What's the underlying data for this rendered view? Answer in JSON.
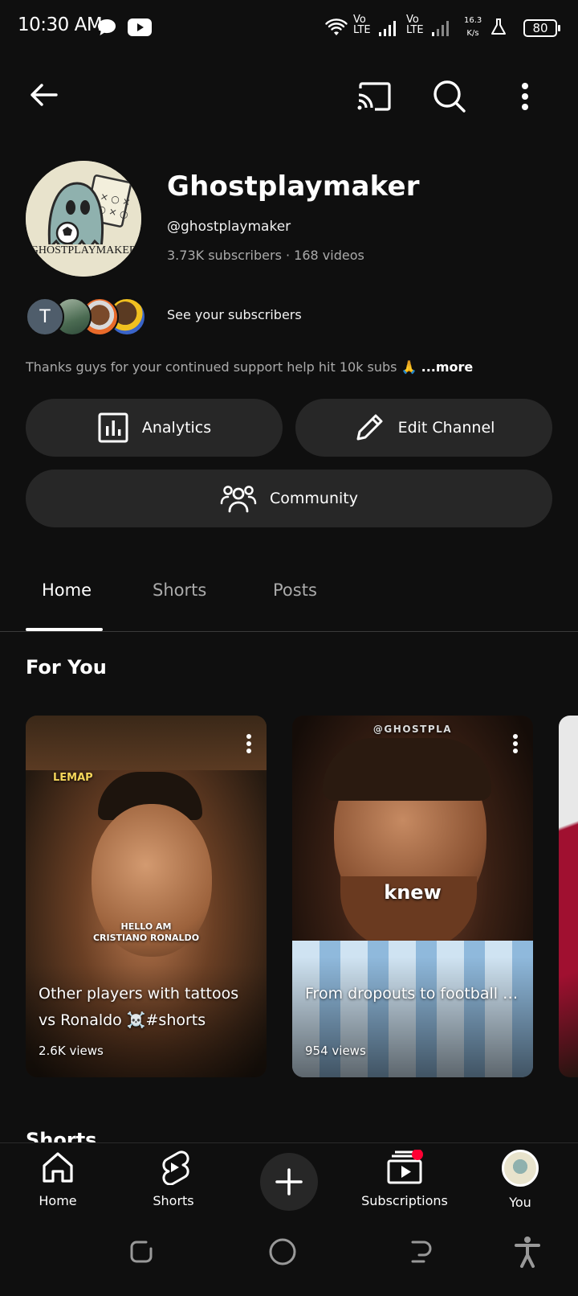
{
  "status_bar": {
    "time": "10:30 AM",
    "network_1": "Vo LTE",
    "network_2": "Vo LTE",
    "speed_value": "16.3",
    "speed_unit": "K/s",
    "battery": "80"
  },
  "channel": {
    "name": "Ghostplaymaker",
    "handle": "@ghostplaymaker",
    "meta": "3.73K subscribers · 168 videos",
    "avatar_text": "GHOSTPLAYMAKER",
    "subscribers_link": "See your subscribers",
    "first_sub_initial": "T",
    "description": "Thanks guys for your continued support help hit 10k subs 🙏",
    "more_label": "...more"
  },
  "actions": {
    "analytics": "Analytics",
    "edit_channel": "Edit Channel",
    "community": "Community"
  },
  "tabs": [
    {
      "label": "Home",
      "active": true
    },
    {
      "label": "Shorts",
      "active": false
    },
    {
      "label": "Posts",
      "active": false
    }
  ],
  "section_for_you": "For You",
  "next_section_peek": "Shorts",
  "cards": [
    {
      "overlay_tag": "LEMAP",
      "overlay_caption_1": "HELLO AM",
      "overlay_caption_2": "CRISTIANO RONALDO",
      "title": "Other players with tattoos vs Ronaldo ☠️#shorts",
      "views": "2.6K views"
    },
    {
      "overlay_tag": "@GHOSTPLA",
      "overlay_caption_1": "knew",
      "title": "From dropouts to football icons#shorts#footballhorts...",
      "views": "954 views"
    }
  ],
  "bottom_nav": {
    "home": "Home",
    "shorts": "Shorts",
    "subscriptions": "Subscriptions",
    "you": "You"
  },
  "colors": {
    "background": "#0f0f0f",
    "pill": "#272727",
    "muted_text": "#aaaaaa",
    "notification_dot": "#ff0033"
  }
}
